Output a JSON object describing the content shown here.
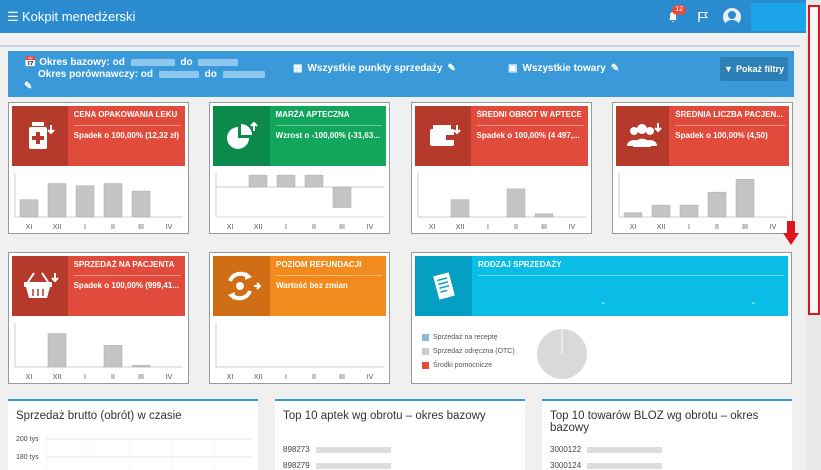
{
  "app": {
    "title": "Kokpit menedżerski",
    "menu_icon": "hamburger-icon",
    "notifications_count": "12"
  },
  "filters": {
    "base_label": "Okres bazowy: od",
    "base_to": "do",
    "compare_label": "Okres porównawczy: od",
    "compare_to": "do",
    "points": "Wszystkie punkty sprzedaży",
    "goods": "Wszystkie towary",
    "show_filters": "Pokaż filtry"
  },
  "months": [
    "XI",
    "XII",
    "I",
    "II",
    "III",
    "IV"
  ],
  "cards": [
    {
      "title": "CENA OPAKOWANIA LEKU",
      "value": "Spadek o 100,00% (12,32 zł)",
      "color": "red",
      "icon": "medicine-bottle-icon",
      "bars": [
        0.32,
        0.62,
        0.58,
        0.62,
        0.48,
        0
      ]
    },
    {
      "title": "MARŻA APTECZNA",
      "value": "Wzrost o -100,00% (-31,63...",
      "color": "green",
      "icon": "pie-chart-icon",
      "bars": [
        0,
        0.22,
        0.22,
        0.22,
        -0.38,
        0
      ]
    },
    {
      "title": "ŚREDNI OBRÓT W APTECE",
      "value": "Spadek o 100,00% (4 497,...",
      "color": "red",
      "icon": "wallet-icon",
      "bars": [
        0,
        0.32,
        0,
        0.52,
        0.06,
        0
      ]
    },
    {
      "title": "ŚREDNIA LICZBA PACJEN...",
      "value": "Spadek o 100,00% (4,50)",
      "color": "red",
      "icon": "users-icon",
      "bars": [
        0.08,
        0.22,
        0.22,
        0.46,
        0.7,
        0
      ]
    },
    {
      "title": "SPRZEDAŻ NA PACJENTA",
      "value": "Spadek o 100,00% (999,41...",
      "color": "red",
      "icon": "basket-icon",
      "bars": [
        0,
        0.62,
        0,
        0.4,
        0.03,
        0
      ]
    },
    {
      "title": "POZIOM REFUNDACJI",
      "value": "Wartość bez zmian",
      "color": "orange",
      "icon": "refresh-icon",
      "bars": [
        0,
        0,
        0,
        0,
        0,
        0
      ]
    }
  ],
  "sales_type": {
    "title": "RODZAJ SPRZEDAŻY",
    "icon": "receipt-icon",
    "dash1": "-",
    "dash2": "-",
    "legend": [
      {
        "label": "Sprzedaż na receptę",
        "color": "#8fb8d6"
      },
      {
        "label": "Sprzedaż odręczna (OTC)",
        "color": "#cccccc"
      },
      {
        "label": "Środki pomocnicze",
        "color": "#e14b3b"
      }
    ]
  },
  "panels": {
    "gross_sales": {
      "title": "Sprzedaż brutto (obrót) w czasie",
      "y_ticks": [
        "200 tys",
        "180 tys"
      ]
    },
    "top_pharmacies": {
      "title": "Top 10 aptek wg obrotu – okres bazowy",
      "rows": [
        "898273",
        "898279"
      ]
    },
    "top_goods": {
      "title": "Top 10 towarów BLOZ wg obrotu – okres bazowy",
      "rows": [
        "3000122",
        "3000124"
      ]
    }
  }
}
